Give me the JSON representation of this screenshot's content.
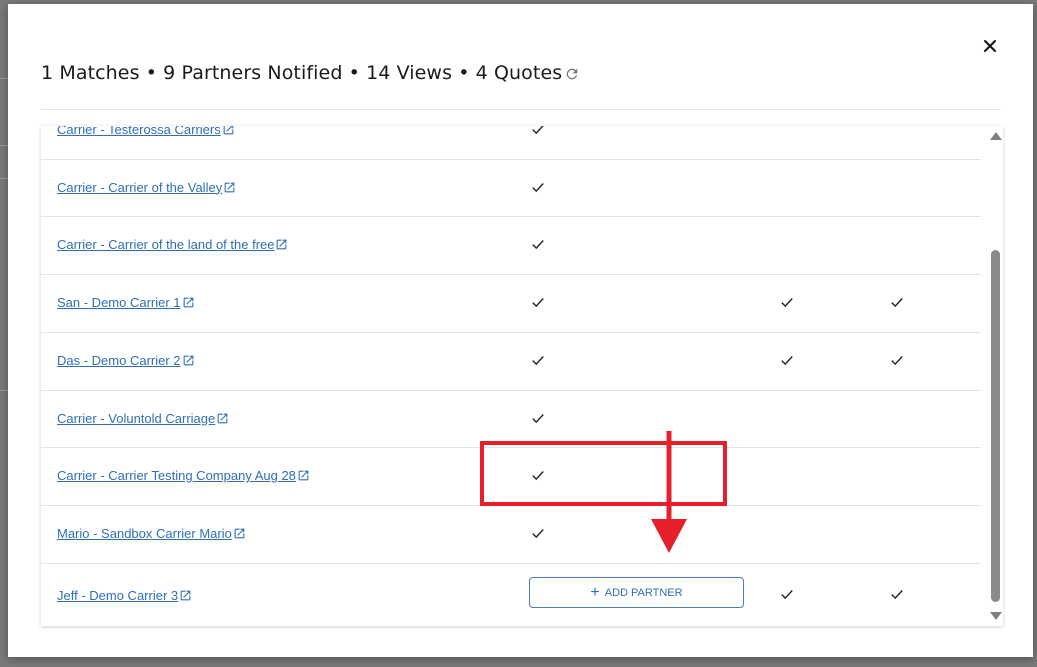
{
  "header": {
    "title": "1 Matches • 9 Partners Notified • 14 Views • 4 Quotes",
    "refresh_icon": "refresh-icon",
    "close_icon": "close-icon"
  },
  "rows": [
    {
      "name": "Carrier - Testerossa Carriers",
      "notified": true,
      "viewed": false,
      "quoted": false
    },
    {
      "name": "Carrier - Carrier of the Valley",
      "notified": true,
      "viewed": false,
      "quoted": false
    },
    {
      "name": "Carrier - Carrier of the land of the free",
      "notified": true,
      "viewed": false,
      "quoted": false
    },
    {
      "name": "San - Demo Carrier 1",
      "notified": true,
      "viewed": true,
      "quoted": true
    },
    {
      "name": "Das - Demo Carrier 2",
      "notified": true,
      "viewed": true,
      "quoted": true
    },
    {
      "name": "Carrier - Voluntold Carriage",
      "notified": true,
      "viewed": false,
      "quoted": false
    },
    {
      "name": "Carrier - Carrier Testing Company Aug 28",
      "notified": true,
      "viewed": false,
      "quoted": false
    },
    {
      "name": "Mario - Sandbox Carrier Mario",
      "notified": true,
      "viewed": false,
      "quoted": false
    },
    {
      "name": "Jeff - Demo Carrier 3",
      "notified": false,
      "viewed": true,
      "quoted": true
    }
  ],
  "add_partner": {
    "label": "ADD PARTNER"
  },
  "colors": {
    "link": "#2f6fb2",
    "highlight": "#e5202a",
    "check": "#222222"
  }
}
